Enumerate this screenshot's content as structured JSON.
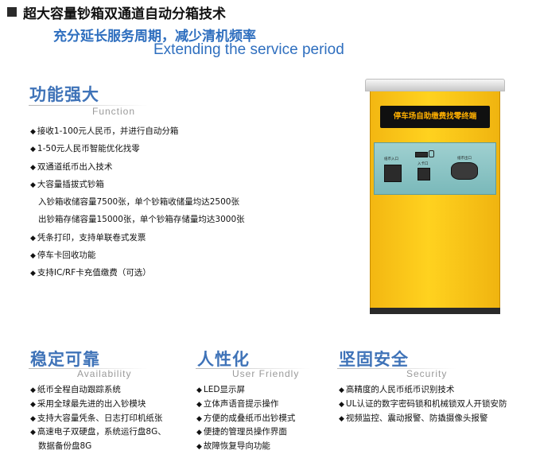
{
  "header": {
    "title": "超大容量钞箱双通道自动分箱技术",
    "subtitle_cn": "充分延长服务周期，减少清机频率",
    "subtitle_en": "Extending the service period"
  },
  "function": {
    "heading": "功能强大",
    "heading_en": "Function",
    "items": [
      {
        "text": "接收1-100元人民币，并进行自动分箱",
        "bullet": true
      },
      {
        "text": "1-50元人民币智能优化找零",
        "bullet": true
      },
      {
        "text": "双通道纸币出入技术",
        "bullet": true
      },
      {
        "text": "大容量插拔式钞箱",
        "bullet": true
      },
      {
        "text": "入钞箱收储容量7500张，单个钞箱收储量均达2500张",
        "bullet": false
      },
      {
        "text": "出钞箱存储容量15000张，单个钞箱存储量均达3000张",
        "bullet": false
      },
      {
        "text": "凭条打印，支持单联卷式发票",
        "bullet": true
      },
      {
        "text": "停车卡回收功能",
        "bullet": true
      },
      {
        "text": "支持IC/RF卡充值缴费（可选）",
        "bullet": true
      }
    ]
  },
  "kiosk": {
    "screen_text": "停车场自助缴费找零终端",
    "label_left": "纸币入口",
    "label_mid": "入卡口",
    "label_right": "纸币出口",
    "colors": {
      "body": "#ffd21f",
      "panel": "#8cc5c6",
      "screen_text": "#ffb000"
    }
  },
  "availability": {
    "heading": "稳定可靠",
    "heading_en": "Availability",
    "items": [
      {
        "text": "纸币全程自动跟踪系统",
        "bullet": true
      },
      {
        "text": "采用全球最先进的出入钞模块",
        "bullet": true
      },
      {
        "text": "支持大容量凭条、日志打印机纸张",
        "bullet": true
      },
      {
        "text": "高速电子双硬盘，系统运行盘8G、",
        "bullet": true
      },
      {
        "text": "数据备份盘8G",
        "bullet": false
      }
    ]
  },
  "user_friendly": {
    "heading": "人性化",
    "heading_en": "User Friendly",
    "items": [
      {
        "text": "LED显示屏",
        "bullet": true
      },
      {
        "text": "立体声语音提示操作",
        "bullet": true
      },
      {
        "text": "方便的成叠纸币出钞模式",
        "bullet": true
      },
      {
        "text": "便捷的管理员操作界面",
        "bullet": true
      },
      {
        "text": "故障恢复导向功能",
        "bullet": true
      }
    ]
  },
  "security": {
    "heading": "坚固安全",
    "heading_en": "Security",
    "items": [
      {
        "text": "高精度的人民币纸币识别技术",
        "bullet": true
      },
      {
        "text": "UL认证的数字密码锁和机械锁双人开锁安防",
        "bullet": true
      },
      {
        "text": "视频监控、震动报警、防撬摄像头报警",
        "bullet": true
      }
    ]
  }
}
